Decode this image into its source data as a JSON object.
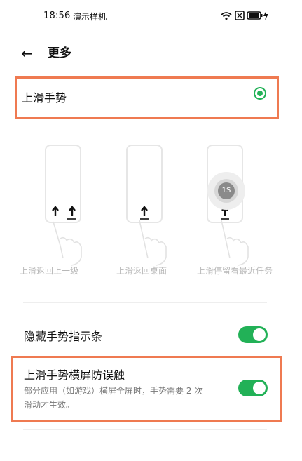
{
  "status_bar": {
    "time": "18:56",
    "app_label": "演示样机",
    "icons": [
      "wifi-icon",
      "sim-icon",
      "battery-charging-icon"
    ]
  },
  "header": {
    "back_icon": "arrow-left-icon",
    "title": "更多"
  },
  "gesture_option": {
    "label": "上滑手势",
    "selected": true
  },
  "gesture_demos": [
    {
      "caption": "上滑返回上一级"
    },
    {
      "caption": "上滑返回桌面"
    },
    {
      "caption": "上滑停留看最近任务",
      "hold_badge": "1S"
    }
  ],
  "settings": {
    "hide_indicator": {
      "label": "隐藏手势指示条",
      "on": true
    },
    "landscape_guard": {
      "label": "上滑手势横屏防误触",
      "desc_line1": "部分应用（如游戏）横屏全屏时，手势需要 2 次",
      "desc_line2": "滑动才生效。",
      "on": true
    }
  },
  "colors": {
    "accent_green": "#22b157",
    "highlight_orange": "#ef7a51"
  }
}
